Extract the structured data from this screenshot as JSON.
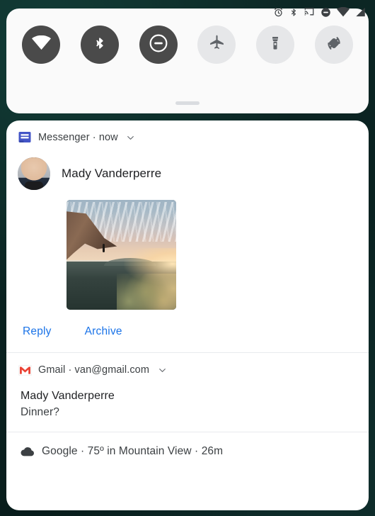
{
  "status_bar": {
    "icons": [
      {
        "name": "alarm-icon",
        "label": "alarm"
      },
      {
        "name": "bluetooth-icon",
        "label": "bluetooth"
      },
      {
        "name": "cast-icon",
        "label": "cast"
      },
      {
        "name": "do-not-disturb-icon",
        "label": "do not disturb"
      },
      {
        "name": "wifi-icon",
        "label": "wifi"
      },
      {
        "name": "cellular-signal-icon",
        "label": "signal"
      }
    ]
  },
  "quick_settings": {
    "tiles": [
      {
        "id": "wifi",
        "label": "Wi-Fi",
        "state": "on"
      },
      {
        "id": "bluetooth",
        "label": "Bluetooth",
        "state": "on"
      },
      {
        "id": "do-not-disturb",
        "label": "Do Not Disturb",
        "state": "on"
      },
      {
        "id": "airplane-mode",
        "label": "Airplane mode",
        "state": "off"
      },
      {
        "id": "flashlight",
        "label": "Flashlight",
        "state": "off"
      },
      {
        "id": "auto-rotate",
        "label": "Auto-rotate",
        "state": "off"
      }
    ],
    "handle_label": "Drag handle"
  },
  "notifications": [
    {
      "app": "Messenger",
      "header": "Messenger · now",
      "time": "now",
      "sender": "Mady Vanderperre",
      "image_alt": "Sunset landscape photo from a clifftop",
      "actions": [
        "Reply",
        "Archive"
      ]
    },
    {
      "app": "Gmail",
      "header": "Gmail · van@gmail.com",
      "account": "van@gmail.com",
      "title": "Mady Vanderperre",
      "body": "Dinner?"
    },
    {
      "app": "Google",
      "header": "Google · 75º in Mountain View · 26m",
      "condition": "75º in Mountain View",
      "time": "26m"
    }
  ],
  "colors": {
    "accent_blue": "#1a73e8",
    "messenger_blue": "#4355c7",
    "gmail_red": "#ea4335",
    "tile_on": "#4a4a4a",
    "tile_off": "#e6e7e9",
    "panel_bg": "#ffffff",
    "wallpaper": "#0b2321"
  }
}
